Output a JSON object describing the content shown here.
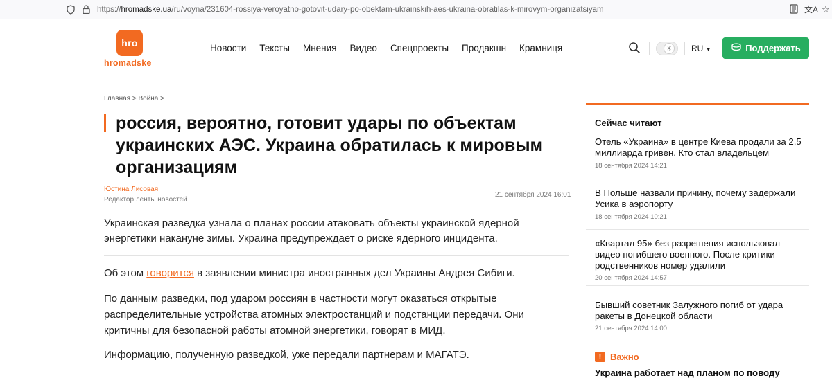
{
  "browser": {
    "url_scheme": "https://",
    "url_host": "hromadske.ua",
    "url_path": "/ru/voyna/231604-rossiya-veroyatno-gotovit-udary-po-obektam-ukrainskih-aes-ukraina-obratilas-k-mirovym-organizatsiyam"
  },
  "site": {
    "logo_mark": "hro",
    "logo_text": "hromadske",
    "nav": [
      "Новости",
      "Тексты",
      "Мнения",
      "Видео",
      "Спецпроекты",
      "Продакшн",
      "Крамниця"
    ],
    "lang": "RU",
    "support_label": "Поддержать",
    "accent": "#f26a21",
    "support_color": "#27ae60"
  },
  "article": {
    "breadcrumb": "Главная > Война >",
    "title": "россия, вероятно, готовит удары по объектам украинских АЭС. Украина обратилась к мировым организациям",
    "author": "Юстина Лисовая",
    "author_role": "Редактор ленты новостей",
    "date": "21 сентября 2024 16:01",
    "lead": "Украинская разведка узнала о планах россии атаковать объекты украинской ядерной энергетики накануне зимы. Украина предупреждает о риске ядерного инцидента.",
    "p1_before": "Об этом ",
    "p1_link": "говорится",
    "p1_after": " в заявлении министра иностранных дел Украины Андрея Сибиги.",
    "p2": "По данным разведки, под ударом россиян в частности могут оказаться открытые распределительные устройства атомных электростанций и подстанции передачи. Они критичны для безопасной работы атомной энергетики, говорят в МИД.",
    "p3": "Информацию, полученную разведкой, уже передали партнерам и МАГАТЭ."
  },
  "sidebar": {
    "heading": "Сейчас читают",
    "items": [
      {
        "title": "Отель «Украина» в центре Киева продали за 2,5 миллиарда гривен. Кто стал владельцем",
        "date": "18 сентября 2024 14:21"
      },
      {
        "title": "В Польше назвали причину, почему задержали Усика в аэропорту",
        "date": "18 сентября 2024 10:21"
      },
      {
        "title": "«Квартал 95» без разрешения использовал видео погибшего военного. После критики родственников номер удалили",
        "date": "20 сентября 2024 14:57"
      },
      {
        "title": "Бывший советник Залужного погиб от удара ракеты в Донецкой области",
        "date": "21 сентября 2024 14:00"
      }
    ],
    "important_icon": "!",
    "important_label": "Важно",
    "important_text": "Украина работает над планом по поводу"
  }
}
